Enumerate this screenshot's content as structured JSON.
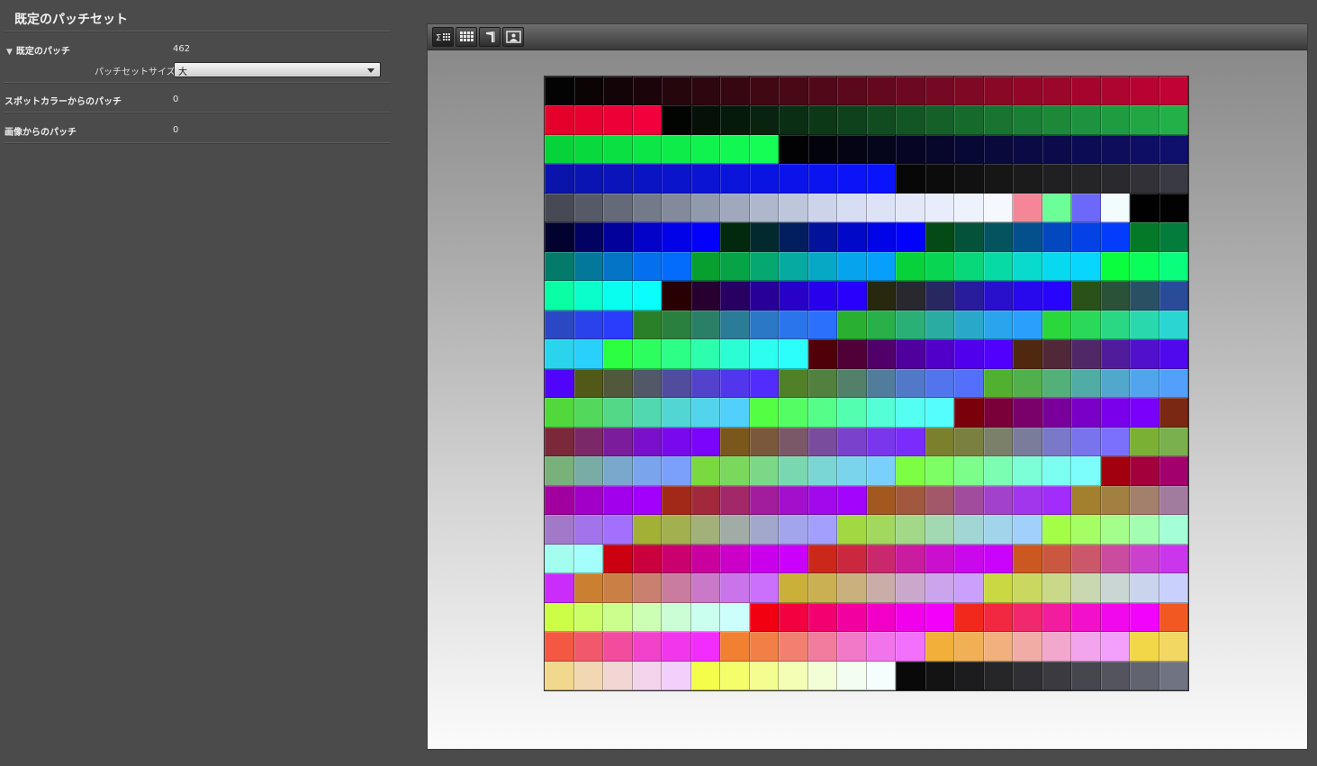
{
  "panel": {
    "title": "既定のパッチセット",
    "rows": [
      {
        "label": "既定のパッチ",
        "value": "462",
        "expanded": true
      },
      {
        "label": "スポットカラーからのパッチ",
        "value": "0"
      },
      {
        "label": "画像からのパッチ",
        "value": "0"
      }
    ],
    "patch_set_size": {
      "label": "パッチセットサイズ：",
      "selected": "大"
    }
  },
  "toolbar": {
    "buttons": [
      {
        "name": "summary-view-button",
        "icon": "sigma-grid-icon",
        "active": true
      },
      {
        "name": "grid-view-button",
        "icon": "grid-icon",
        "active": false
      },
      {
        "name": "spectrum-view-button",
        "icon": "spectrum-icon",
        "active": false
      },
      {
        "name": "image-view-button",
        "icon": "image-icon",
        "active": false
      }
    ]
  },
  "patch_grid": {
    "columns": 22,
    "rows": 21,
    "colors": [
      [
        "#030303",
        "#0c0305",
        "#130407",
        "#1c050a",
        "#25060c",
        "#2d060f",
        "#360711",
        "#3f0813",
        "#480816",
        "#510818",
        "#5a081a",
        "#63081d",
        "#6c081f",
        "#750822",
        "#7f0824",
        "#880826",
        "#920728",
        "#9b062b",
        "#a5052d",
        "#ae0430",
        "#b80332",
        "#c10235"
      ],
      [
        "#e4002a",
        "#e80030",
        "#ed0036",
        "#f1003c",
        "#020402",
        "#041008",
        "#061a0c",
        "#082410",
        "#0a2e14",
        "#0c3818",
        "#0e421c",
        "#104c20",
        "#125624",
        "#146028",
        "#166a2c",
        "#187430",
        "#1a7e34",
        "#1c8838",
        "#1e923c",
        "#209c40",
        "#22a644",
        "#24b048"
      ],
      [
        "#06d23a",
        "#08da3e",
        "#0ae042",
        "#0ce646",
        "#0eec4a",
        "#10f24e",
        "#12f852",
        "#14fe56",
        "#020204",
        "#03030c",
        "#040414",
        "#05051c",
        "#060624",
        "#07072c",
        "#080834",
        "#09093c",
        "#0a0a44",
        "#0b0b4c",
        "#0c0c54",
        "#0d0d5c",
        "#0e0e64",
        "#0f0f6c"
      ],
      [
        "#0a14aa",
        "#0a14b2",
        "#0a14ba",
        "#0a14c2",
        "#0a14ca",
        "#0a14d2",
        "#0a14da",
        "#0a14e2",
        "#0a14ea",
        "#0a14f0",
        "#0a14f6",
        "#0a14fc",
        "#070707",
        "#0c0c0c",
        "#111111",
        "#161616",
        "#1b1b1c",
        "#202022",
        "#252528",
        "#2a2a2e",
        "#313137",
        "#393a42"
      ],
      [
        "#474a54",
        "#555a66",
        "#646a78",
        "#737a8a",
        "#828a9c",
        "#9199ad",
        "#a0a8bd",
        "#afb7cd",
        "#bec6dc",
        "#cdd4ea",
        "#d7ddf2",
        "#dde3f6",
        "#e3e8f9",
        "#e8edfb",
        "#eef2fd",
        "#f5f8ff",
        "#f48698",
        "#6cfe98",
        "#6c68fa",
        "#f2fbfd",
        "#010101",
        "#020202"
      ],
      [
        "#02022e",
        "#020262",
        "#02029a",
        "#0202c8",
        "#0202e8",
        "#0202fc",
        "#02280e",
        "#022a2e",
        "#021e5e",
        "#02129a",
        "#0208c8",
        "#0204e8",
        "#0202fc",
        "#044a16",
        "#04523a",
        "#045460",
        "#04508c",
        "#0448c0",
        "#0442e8",
        "#043cfc",
        "#047a28",
        "#047c3c"
      ],
      [
        "#047a6a",
        "#04789a",
        "#0474c6",
        "#0470f0",
        "#046cfc",
        "#06a02e",
        "#06a446",
        "#06a872",
        "#06aaa0",
        "#06a8c6",
        "#06a4ec",
        "#06a0fc",
        "#08d23a",
        "#08d652",
        "#08d87a",
        "#08daa6",
        "#08dace",
        "#08d8f0",
        "#08d6fc",
        "#0afe3e",
        "#0afe5a",
        "#0afe7e"
      ],
      [
        "#0afea4",
        "#0afecc",
        "#0afef0",
        "#0afefc",
        "#280004",
        "#280030",
        "#280062",
        "#280098",
        "#2800c8",
        "#2800ec",
        "#2800fc",
        "#28280e",
        "#28282e",
        "#282860",
        "#281c9c",
        "#2810cc",
        "#2808ec",
        "#2804fc",
        "#2a5218",
        "#2a5238",
        "#2a5064",
        "#2a4c98"
      ],
      [
        "#2a48c4",
        "#2a42ec",
        "#2a3cfc",
        "#2a8028",
        "#2a803e",
        "#2a8066",
        "#2a7c98",
        "#2a78c6",
        "#2a74ec",
        "#2a70fc",
        "#2ab030",
        "#2ab04a",
        "#2ab076",
        "#2aaca2",
        "#2aa8ca",
        "#2aa4ec",
        "#2aa0fc",
        "#2ad83c",
        "#2ad85a",
        "#2ad884",
        "#2ad8ae",
        "#2ad6d2"
      ],
      [
        "#2ad4ec",
        "#2ad0fc",
        "#2cfe42",
        "#2cfe60",
        "#2cfe86",
        "#2cfeae",
        "#2cfed4",
        "#2cfef0",
        "#2cfefc",
        "#500008",
        "#500036",
        "#500068",
        "#50009c",
        "#5000c8",
        "#5000ec",
        "#5000fc",
        "#502810",
        "#502838",
        "#502868",
        "#501c9c",
        "#5010cc",
        "#5008ec"
      ],
      [
        "#5004fc",
        "#525818",
        "#52583a",
        "#525868",
        "#524c9e",
        "#5242cc",
        "#5236ec",
        "#522cfc",
        "#528028",
        "#52803e",
        "#528068",
        "#527c9c",
        "#5278c8",
        "#5274ec",
        "#5270fc",
        "#52b030",
        "#52b04c",
        "#52b078",
        "#52aca6",
        "#52a8cc",
        "#52a4ec",
        "#52a0fc"
      ],
      [
        "#52d83c",
        "#52d85a",
        "#52d886",
        "#52d8b0",
        "#52d6d4",
        "#52d4ec",
        "#52d0fc",
        "#54fe42",
        "#54fe62",
        "#54fe88",
        "#54feb0",
        "#54fed6",
        "#54fef0",
        "#54fefc",
        "#7a000c",
        "#7a003a",
        "#7a006a",
        "#7a009c",
        "#7a00c8",
        "#7a00ec",
        "#7a00fc",
        "#7a2814"
      ],
      [
        "#7a283a",
        "#7a2868",
        "#7a1c9c",
        "#7a10cc",
        "#7a08ec",
        "#7a04fc",
        "#7a581c",
        "#7a583c",
        "#7a5868",
        "#7a4c9e",
        "#7a42cc",
        "#7a36ec",
        "#7a2cfc",
        "#7a802c",
        "#7a8040",
        "#7a806a",
        "#7a7c9c",
        "#7a78c8",
        "#7a74ec",
        "#7a70fc",
        "#7ab034",
        "#7ab04e"
      ],
      [
        "#7ab07a",
        "#7aaca6",
        "#7aa8cc",
        "#7aa4ec",
        "#7aa0fc",
        "#7ad840",
        "#7ad85c",
        "#7ad886",
        "#7ad8b0",
        "#7ad6d4",
        "#7ad4ec",
        "#7ad0fc",
        "#7cfe44",
        "#7cfe64",
        "#7cfe8a",
        "#7cfeb2",
        "#7cfed6",
        "#7cfef0",
        "#7cfefc",
        "#a2000e",
        "#a2003c",
        "#a2006c"
      ],
      [
        "#a2009e",
        "#a200c8",
        "#a200ec",
        "#a200fc",
        "#a22818",
        "#a2283c",
        "#a2286a",
        "#a21c9e",
        "#a210cc",
        "#a208ec",
        "#a204fc",
        "#a2581e",
        "#a2583e",
        "#a25868",
        "#a24c9e",
        "#a242cc",
        "#a236ec",
        "#a22cfc",
        "#a2802e",
        "#a28042",
        "#a2806c",
        "#a27c9e"
      ],
      [
        "#a278c8",
        "#a274ec",
        "#a270fc",
        "#a2b036",
        "#a2b050",
        "#a2b07a",
        "#a2aca6",
        "#a2a8cc",
        "#a2a4ec",
        "#a2a0fc",
        "#a2d842",
        "#a2d85e",
        "#a2d888",
        "#a2d8b2",
        "#a2d6d4",
        "#a2d4ec",
        "#a2d0fc",
        "#a4fe46",
        "#a4fe66",
        "#a4fe8c",
        "#a4feb2",
        "#a4fed6"
      ],
      [
        "#a4fef0",
        "#a4fefc",
        "#ca0010",
        "#ca003e",
        "#ca006e",
        "#ca009e",
        "#ca00c8",
        "#ca00ec",
        "#ca00fc",
        "#ca281a",
        "#ca283e",
        "#ca286c",
        "#ca1c9e",
        "#ca10cc",
        "#ca08ec",
        "#ca04fc",
        "#ca5820",
        "#ca5840",
        "#ca586a",
        "#ca4c9e",
        "#ca42cc",
        "#ca36ec"
      ],
      [
        "#ca2cfc",
        "#ca8030",
        "#ca8044",
        "#ca806e",
        "#ca7c9e",
        "#ca78c8",
        "#ca74ec",
        "#ca70fc",
        "#cab038",
        "#cab052",
        "#cab07c",
        "#caaca8",
        "#caa8cc",
        "#caa4ec",
        "#caa0fc",
        "#cad844",
        "#cad860",
        "#cad88a",
        "#cad8b2",
        "#cad6d4",
        "#cad4ec",
        "#cad0fc"
      ],
      [
        "#ccfe48",
        "#ccfe68",
        "#ccfe8e",
        "#ccfeb4",
        "#ccfed6",
        "#ccfef0",
        "#ccfefc",
        "#f20012",
        "#f20040",
        "#f20070",
        "#f200a0",
        "#f200c8",
        "#f200ec",
        "#f200fc",
        "#f2281c",
        "#f22840",
        "#f2286e",
        "#f21c9e",
        "#f210cc",
        "#f208ec",
        "#f204fc",
        "#f25822"
      ],
      [
        "#f25842",
        "#f2586c",
        "#f24c9e",
        "#f242cc",
        "#f236ec",
        "#f22cfc",
        "#f28032",
        "#f28046",
        "#f28070",
        "#f27c9e",
        "#f278c8",
        "#f274ec",
        "#f270fc",
        "#f2b03a",
        "#f2b054",
        "#f2b07e",
        "#f2aca8",
        "#f2a8cc",
        "#f2a4ec",
        "#f2a0fc",
        "#f2d846",
        "#f2d862"
      ],
      [
        "#f2d88c",
        "#f2d8b2",
        "#f2d6d4",
        "#f2d4ec",
        "#f2d0fc",
        "#f4fe4a",
        "#f4fe6a",
        "#f4fe90",
        "#f4feb4",
        "#f4fed6",
        "#f4fef0",
        "#f4fefc",
        "#090909",
        "#131313",
        "#1c1c1e",
        "#262628",
        "#303034",
        "#3a3a40",
        "#46474e",
        "#53545e",
        "#61636e",
        "#707381"
      ]
    ]
  }
}
